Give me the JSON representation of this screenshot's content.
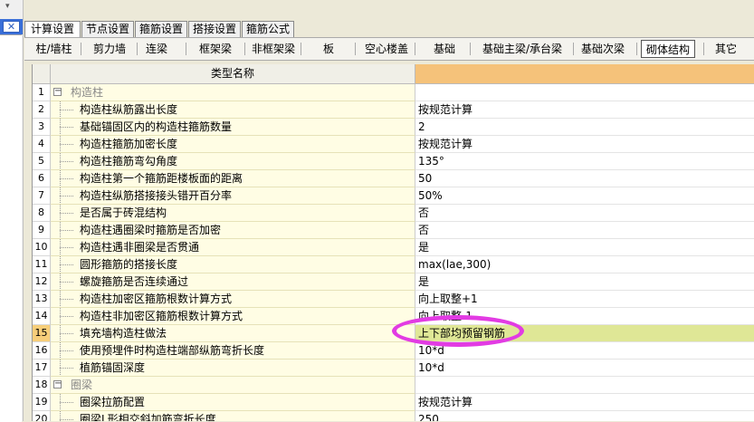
{
  "left_panel": {
    "close_label": "✕",
    "arrow": "▾"
  },
  "tabs1": [
    {
      "label": "计算设置",
      "active": true
    },
    {
      "label": "节点设置",
      "active": false
    },
    {
      "label": "箍筋设置",
      "active": false
    },
    {
      "label": "搭接设置",
      "active": false
    },
    {
      "label": "箍筋公式",
      "active": false
    }
  ],
  "tabs2": [
    {
      "label": "柱/墙柱",
      "active": false
    },
    {
      "label": "剪力墙",
      "active": false
    },
    {
      "label": "连梁",
      "active": false
    },
    {
      "label": "框架梁",
      "active": false
    },
    {
      "label": "非框架梁",
      "active": false
    },
    {
      "label": "板",
      "active": false
    },
    {
      "label": "空心楼盖",
      "active": false
    },
    {
      "label": "基础",
      "active": false
    },
    {
      "label": "基础主梁/承台梁",
      "active": false
    },
    {
      "label": "基础次梁",
      "active": false
    },
    {
      "label": "砌体结构",
      "active": true
    },
    {
      "label": "其它",
      "active": false
    }
  ],
  "grid": {
    "header": {
      "name_col": "类型名称",
      "value_col": ""
    },
    "selected_row": 15,
    "rows": [
      {
        "num": "1",
        "name": "构造柱",
        "value": "",
        "group": true
      },
      {
        "num": "2",
        "name": "构造柱纵筋露出长度",
        "value": "按规范计算"
      },
      {
        "num": "3",
        "name": "基础锚固区内的构造柱箍筋数量",
        "value": "2"
      },
      {
        "num": "4",
        "name": "构造柱箍筋加密长度",
        "value": "按规范计算"
      },
      {
        "num": "5",
        "name": "构造柱箍筋弯勾角度",
        "value": "135°"
      },
      {
        "num": "6",
        "name": "构造柱第一个箍筋距楼板面的距离",
        "value": "50"
      },
      {
        "num": "7",
        "name": "构造柱纵筋搭接接头错开百分率",
        "value": "50%"
      },
      {
        "num": "8",
        "name": "是否属于砖混结构",
        "value": "否"
      },
      {
        "num": "9",
        "name": "构造柱遇圈梁时箍筋是否加密",
        "value": "否"
      },
      {
        "num": "10",
        "name": "构造柱遇非圈梁是否贯通",
        "value": "是"
      },
      {
        "num": "11",
        "name": "圆形箍筋的搭接长度",
        "value": "max(lae,300)"
      },
      {
        "num": "12",
        "name": "螺旋箍筋是否连续通过",
        "value": "是"
      },
      {
        "num": "13",
        "name": "构造柱加密区箍筋根数计算方式",
        "value": "向上取整+1"
      },
      {
        "num": "14",
        "name": "构造柱非加密区箍筋根数计算方式",
        "value": "向上取整-1"
      },
      {
        "num": "15",
        "name": "填充墙构造柱做法",
        "value": "上下部均预留钢筋"
      },
      {
        "num": "16",
        "name": "使用预埋件时构造柱端部纵筋弯折长度",
        "value": "10*d"
      },
      {
        "num": "17",
        "name": "植筋锚固深度",
        "value": "10*d"
      },
      {
        "num": "18",
        "name": "圈梁",
        "value": "",
        "group": true
      },
      {
        "num": "19",
        "name": "圈梁拉筋配置",
        "value": "按规范计算"
      },
      {
        "num": "20",
        "name": "圈梁L形相交斜加筋弯折长度",
        "value": "250"
      }
    ]
  },
  "annotation": {
    "color": "#e23be3"
  }
}
